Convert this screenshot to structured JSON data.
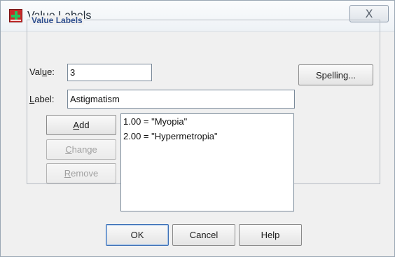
{
  "window": {
    "title": "Value Labels",
    "close_icon": "close-x-icon",
    "close_glyph": "X",
    "app_icon": "app-logo-icon"
  },
  "group": {
    "title": "Value Labels"
  },
  "value_field": {
    "label_pre": "Val",
    "label_mnemonic": "u",
    "label_post": "e:",
    "value": "3"
  },
  "label_field": {
    "label_mnemonic": "L",
    "label_post": "abel:",
    "value": "Astigmatism"
  },
  "buttons": {
    "spelling": "Spelling...",
    "add": {
      "mnemonic": "A",
      "rest": "dd",
      "enabled": true
    },
    "change": {
      "mnemonic": "C",
      "rest": "hange",
      "enabled": false
    },
    "remove": {
      "mnemonic": "R",
      "rest": "emove",
      "enabled": false
    }
  },
  "labels_list": [
    "1.00 = \"Myopia\"",
    "2.00 = \"Hypermetropia\""
  ],
  "footer": {
    "ok": "OK",
    "cancel": "Cancel",
    "help": "Help"
  }
}
